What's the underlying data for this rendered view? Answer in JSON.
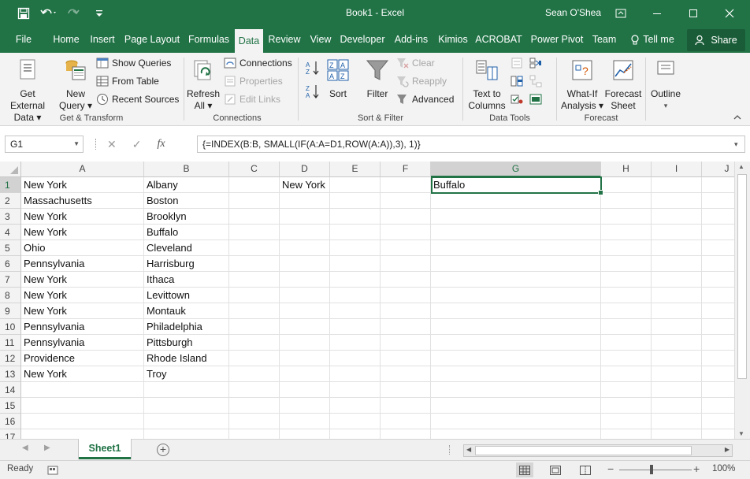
{
  "window": {
    "title": "Book1  -  Excel",
    "user": "Sean O'Shea",
    "accent": "#217346"
  },
  "quick_access": [
    "save-icon",
    "undo-icon",
    "redo-icon",
    "customize-icon"
  ],
  "tabs": [
    "File",
    "Home",
    "Insert",
    "Page Layout",
    "Formulas",
    "Data",
    "Review",
    "View",
    "Developer",
    "Add-ins",
    "Kimios",
    "ACROBAT",
    "Power Pivot",
    "Team"
  ],
  "active_tab": "Data",
  "tell_me": "Tell me",
  "share": "Share",
  "ribbon": {
    "get_external_data": [
      "Get External",
      "Data"
    ],
    "new_query": [
      "New",
      "Query"
    ],
    "show_queries": "Show Queries",
    "from_table": "From Table",
    "recent_sources": "Recent Sources",
    "group_get_transform": "Get & Transform",
    "refresh_all": [
      "Refresh",
      "All"
    ],
    "connections": "Connections",
    "properties": "Properties",
    "edit_links": "Edit Links",
    "group_connections": "Connections",
    "sort": "Sort",
    "filter": "Filter",
    "clear": "Clear",
    "reapply": "Reapply",
    "advanced": "Advanced",
    "group_sort_filter": "Sort & Filter",
    "text_to_columns": [
      "Text to",
      "Columns"
    ],
    "group_data_tools": "Data Tools",
    "what_if": [
      "What-If",
      "Analysis"
    ],
    "forecast_sheet": [
      "Forecast",
      "Sheet"
    ],
    "group_forecast": "Forecast",
    "outline": "Outline"
  },
  "formula_bar": {
    "name_box": "G1",
    "fx": "fx",
    "formula": "{=INDEX(B:B, SMALL(IF(A:A=D1,ROW(A:A)),3), 1)}"
  },
  "columns": [
    "A",
    "B",
    "C",
    "D",
    "E",
    "F",
    "G",
    "H",
    "I",
    "J"
  ],
  "selected_column": "G",
  "rows": [
    {
      "n": "1",
      "A": "New York",
      "B": "Albany",
      "D": "New York",
      "G": "Buffalo"
    },
    {
      "n": "2",
      "A": "Massachusetts",
      "B": "Boston"
    },
    {
      "n": "3",
      "A": "New York",
      "B": "Brooklyn"
    },
    {
      "n": "4",
      "A": "New York",
      "B": "Buffalo"
    },
    {
      "n": "5",
      "A": "Ohio",
      "B": "Cleveland"
    },
    {
      "n": "6",
      "A": "Pennsylvania",
      "B": "Harrisburg"
    },
    {
      "n": "7",
      "A": "New York",
      "B": "Ithaca"
    },
    {
      "n": "8",
      "A": "New York",
      "B": "Levittown"
    },
    {
      "n": "9",
      "A": "New York",
      "B": "Montauk"
    },
    {
      "n": "10",
      "A": "Pennsylvania",
      "B": "Philadelphia"
    },
    {
      "n": "11",
      "A": "Pennsylvania",
      "B": "Pittsburgh"
    },
    {
      "n": "12",
      "A": "Providence",
      "B": "Rhode Island"
    },
    {
      "n": "13",
      "A": "New York",
      "B": "Troy"
    },
    {
      "n": "14"
    },
    {
      "n": "15"
    },
    {
      "n": "16"
    },
    {
      "n": "17"
    }
  ],
  "sheet_tab": "Sheet1",
  "status": {
    "ready": "Ready",
    "zoom": "100%"
  }
}
